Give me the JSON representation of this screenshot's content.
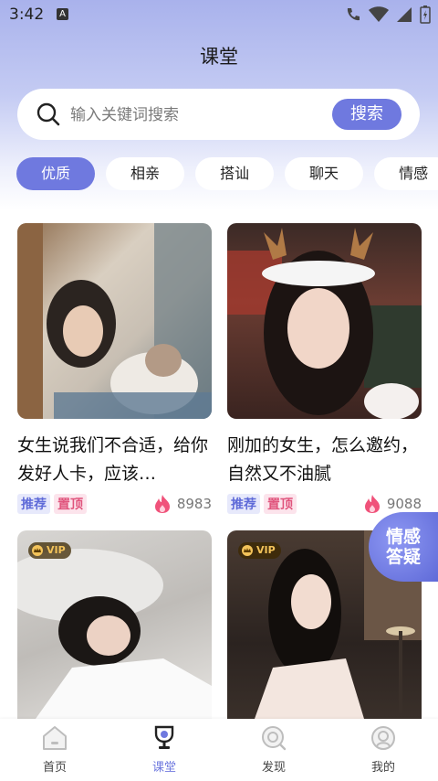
{
  "status_bar": {
    "time": "3:42",
    "a_badge": "A"
  },
  "header": {
    "title": "课堂"
  },
  "search": {
    "placeholder": "输入关键词搜索",
    "button_label": "搜索"
  },
  "tabs": [
    {
      "label": "优质",
      "active": true
    },
    {
      "label": "相亲"
    },
    {
      "label": "搭讪"
    },
    {
      "label": "聊天"
    },
    {
      "label": "情感"
    }
  ],
  "cards": [
    {
      "title": "女生说我们不合适，给你发好人卡，应该…",
      "tag_rec": "推荐",
      "tag_top": "置顶",
      "heat": "8983",
      "vip": false
    },
    {
      "title": "刚加的女生，怎么邀约，自然又不油腻",
      "tag_rec": "推荐",
      "tag_top": "置顶",
      "heat": "9088",
      "vip": false
    },
    {
      "vip": true,
      "vip_label": "VIP"
    },
    {
      "vip": true,
      "vip_label": "VIP"
    }
  ],
  "floating_button": {
    "line1": "情感",
    "line2": "答疑"
  },
  "bottom_nav": [
    {
      "label": "首页",
      "icon": "home-icon"
    },
    {
      "label": "课堂",
      "icon": "trophy-icon",
      "active": true
    },
    {
      "label": "发现",
      "icon": "discover-icon"
    },
    {
      "label": "我的",
      "icon": "profile-icon"
    }
  ],
  "colors": {
    "accent": "#6f79df",
    "tag_rec": "#5f6bd8",
    "tag_top": "#e0557d",
    "heat_flame": "#f0527a"
  }
}
